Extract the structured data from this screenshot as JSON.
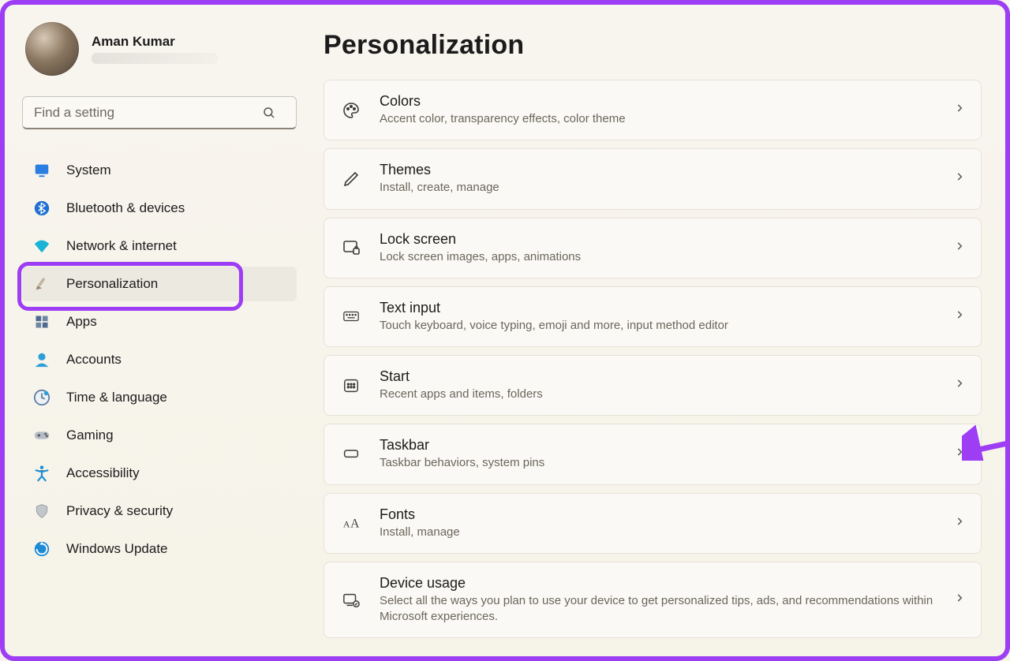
{
  "user": {
    "name": "Aman Kumar"
  },
  "search": {
    "placeholder": "Find a setting"
  },
  "nav": [
    {
      "label": "System",
      "icon": "display-icon",
      "color": "#2a7de1"
    },
    {
      "label": "Bluetooth & devices",
      "icon": "bluetooth-icon",
      "color": "#1f6fd0"
    },
    {
      "label": "Network & internet",
      "icon": "wifi-icon",
      "color": "#19b3d6"
    },
    {
      "label": "Personalization",
      "icon": "paintbrush-icon",
      "color": "#9a8570",
      "selected": true
    },
    {
      "label": "Apps",
      "icon": "apps-icon",
      "color": "#4e6b8f"
    },
    {
      "label": "Accounts",
      "icon": "person-icon",
      "color": "#2e9ed9"
    },
    {
      "label": "Time & language",
      "icon": "clock-icon",
      "color": "#5d7fa5"
    },
    {
      "label": "Gaming",
      "icon": "gamepad-icon",
      "color": "#8f98a3"
    },
    {
      "label": "Accessibility",
      "icon": "accessibility-icon",
      "color": "#1d8fd4"
    },
    {
      "label": "Privacy & security",
      "icon": "shield-icon",
      "color": "#9da3aa"
    },
    {
      "label": "Windows Update",
      "icon": "update-icon",
      "color": "#1e8ad6"
    }
  ],
  "page": {
    "title": "Personalization"
  },
  "cards": [
    {
      "title": "Colors",
      "sub": "Accent color, transparency effects, color theme",
      "icon": "palette-icon"
    },
    {
      "title": "Themes",
      "sub": "Install, create, manage",
      "icon": "pen-icon"
    },
    {
      "title": "Lock screen",
      "sub": "Lock screen images, apps, animations",
      "icon": "lockscreen-icon"
    },
    {
      "title": "Text input",
      "sub": "Touch keyboard, voice typing, emoji and more, input method editor",
      "icon": "keyboard-icon"
    },
    {
      "title": "Start",
      "sub": "Recent apps and items, folders",
      "icon": "start-icon"
    },
    {
      "title": "Taskbar",
      "sub": "Taskbar behaviors, system pins",
      "icon": "taskbar-icon"
    },
    {
      "title": "Fonts",
      "sub": "Install, manage",
      "icon": "fonts-icon"
    },
    {
      "title": "Device usage",
      "sub": "Select all the ways you plan to use your device to get personalized tips, ads, and recommendations within Microsoft experiences.",
      "icon": "deviceusage-icon",
      "tall": true
    }
  ],
  "annotations": {
    "highlight_nav_index": 3,
    "arrow_target_card_index": 5
  }
}
